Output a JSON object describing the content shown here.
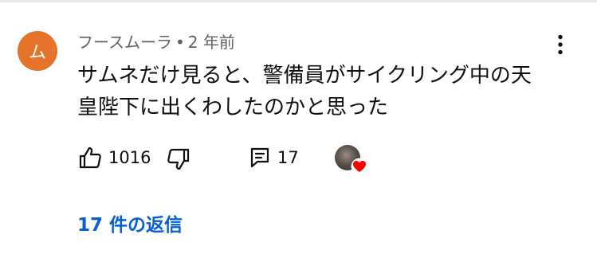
{
  "comment": {
    "avatar_initial": "ム",
    "author": "フースムーラ",
    "separator": "•",
    "timestamp": "2 年前",
    "text_lines": [
      "サムネだけ見ると、警備員がサイクリング中の天",
      "皇陛下に出くわしたのかと思った"
    ]
  },
  "actions": {
    "like_count": "1016",
    "reply_count": "17"
  },
  "replies": {
    "label": "17 件の返信"
  },
  "colors": {
    "avatar_bg": "#e5742a",
    "link": "#065fd4",
    "meta_text": "#606060",
    "heart": "#ff0000"
  },
  "icons": {
    "like": "thumbs-up-icon",
    "dislike": "thumbs-down-icon",
    "reply": "comment-icon",
    "more": "more-vertical-icon",
    "creator_heart": "heart-icon"
  }
}
